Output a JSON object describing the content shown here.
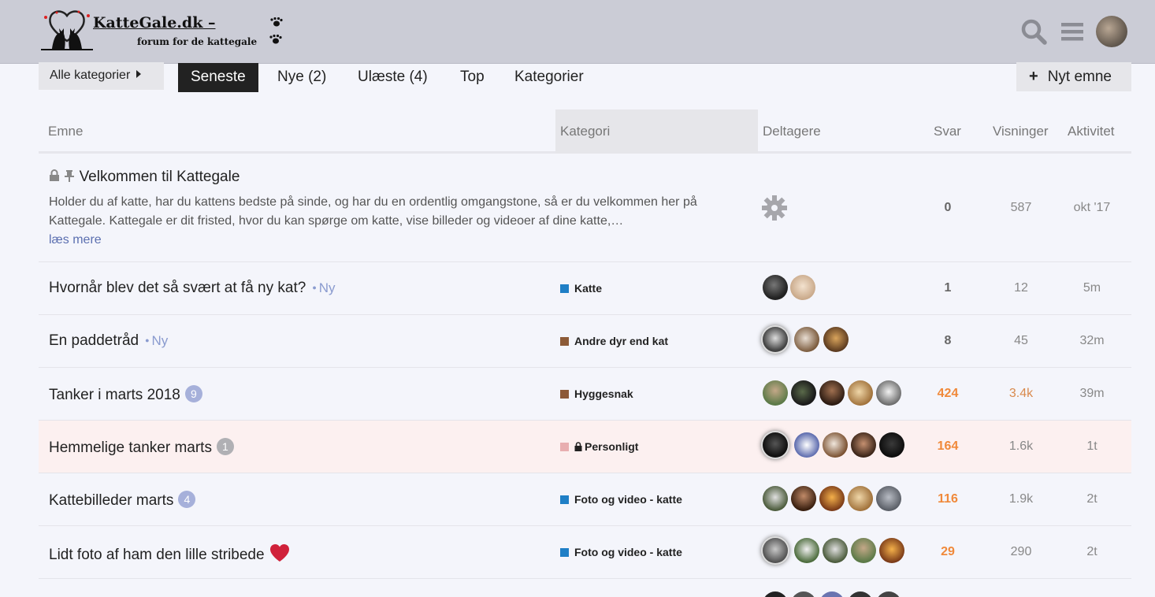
{
  "header": {
    "logo_title": "KatteGale.dk –",
    "logo_subtitle": "forum for de kattegale",
    "icons": [
      "cats-heart-logo-icon",
      "paw-icon",
      "search-icon",
      "hamburger-icon",
      "user-avatar"
    ]
  },
  "nav": {
    "category_dropdown": "Alle kategorier",
    "tabs": [
      "Seneste",
      "Nye (2)",
      "Ulæste (4)",
      "Top",
      "Kategorier"
    ],
    "active_tab": "Seneste",
    "new_topic": "Nyt emne"
  },
  "columns": {
    "topic": "Emne",
    "category": "Kategori",
    "participants": "Deltagere",
    "replies": "Svar",
    "views": "Visninger",
    "activity": "Aktivitet"
  },
  "colors": {
    "katte": "#1f7fc6",
    "andre_dyr": "#8c5a37",
    "hyggesnak": "#8c5a37",
    "personligt": "#e8aeb0",
    "foto": "#1f7fc6",
    "hot_number": "#f0893a"
  },
  "topics": [
    {
      "title": "Velkommen til Kattegale",
      "excerpt": "Holder du af katte, har du kattens bedste på sinde, og har du en ordentlig omgangstone, så er du velkommen her på Kattegale. Kattegale er dit fristed, hvor du kan spørge om katte, vise billeder og videoer af dine katte,…",
      "read_more": "læs mere",
      "replies": "0",
      "views": "587",
      "activity": "okt '17"
    },
    {
      "title": "Hvornår blev det så svært at få ny kat?",
      "new": "Ny",
      "category": "Katte",
      "replies": "1",
      "views": "12",
      "activity": "5m"
    },
    {
      "title": "En paddetråd",
      "new": "Ny",
      "category": "Andre dyr end kat",
      "replies": "8",
      "views": "45",
      "activity": "32m"
    },
    {
      "title": "Tanker i marts 2018",
      "badge": "9",
      "category": "Hyggesnak",
      "replies": "424",
      "views": "3.4k",
      "activity": "39m"
    },
    {
      "title": "Hemmelige tanker marts",
      "badge": "1",
      "category": "Personligt",
      "replies": "164",
      "views": "1.6k",
      "activity": "1t"
    },
    {
      "title": "Kattebilleder marts",
      "badge": "4",
      "category": "Foto og video - katte",
      "replies": "116",
      "views": "1.9k",
      "activity": "2t"
    },
    {
      "title": "Lidt foto af ham den lille stribede",
      "category": "Foto og video - katte",
      "replies": "29",
      "views": "290",
      "activity": "2t"
    }
  ]
}
